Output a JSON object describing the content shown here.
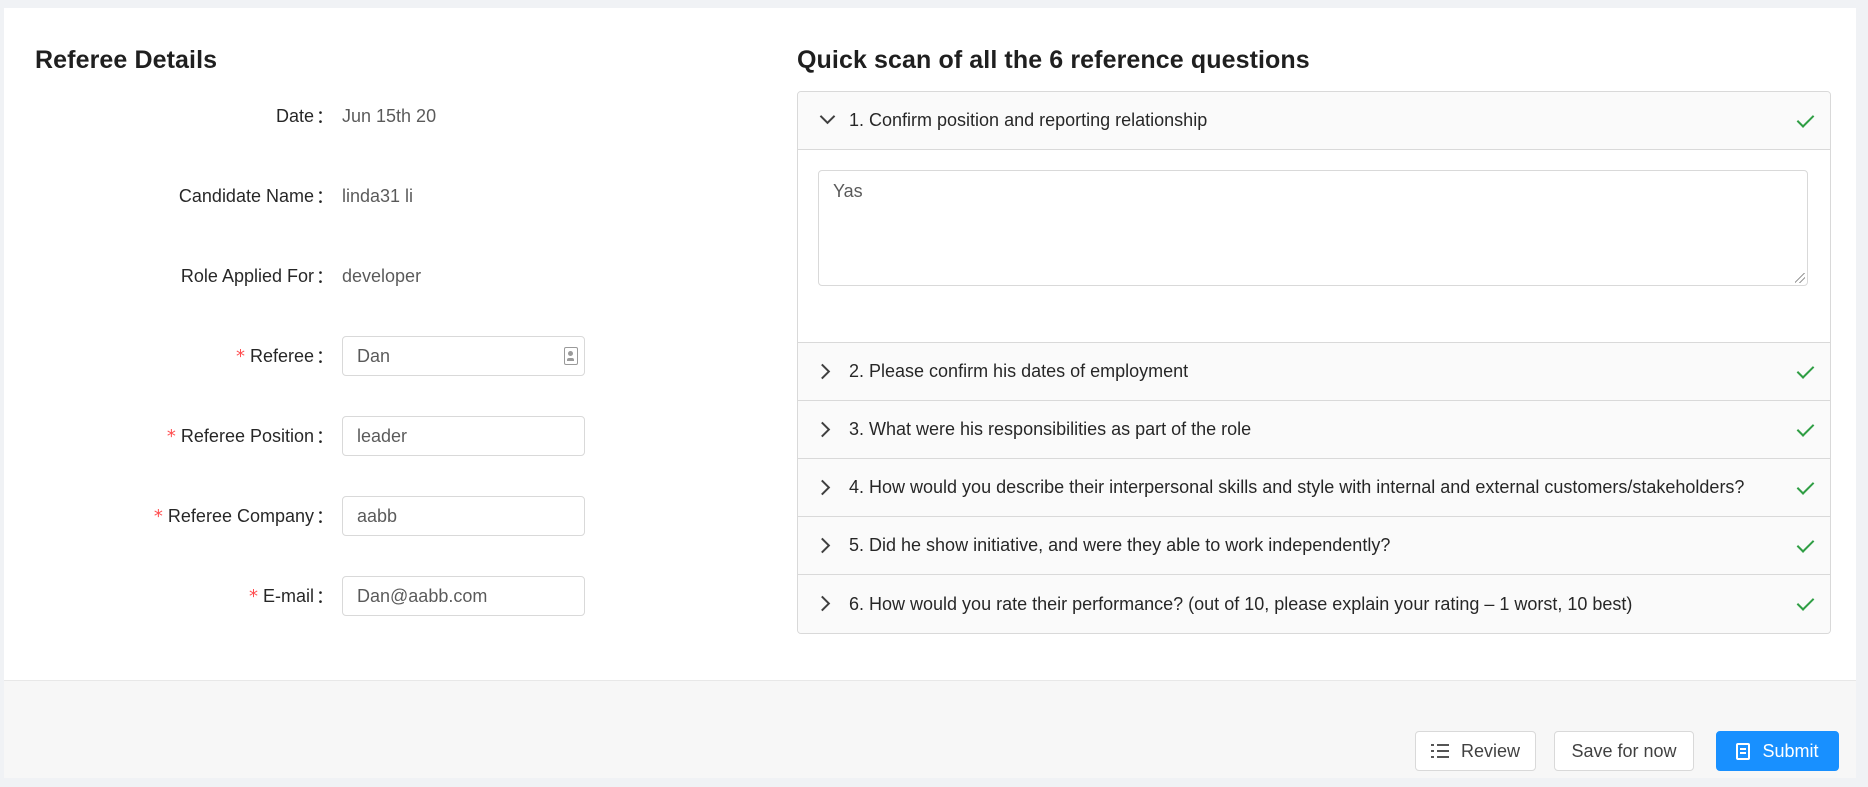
{
  "referee_details": {
    "title": "Referee Details",
    "fields": [
      {
        "label": "Date",
        "value": "Jun 15th 20",
        "required": false,
        "type": "text"
      },
      {
        "label": "Candidate Name",
        "value": "linda31 li",
        "required": false,
        "type": "text"
      },
      {
        "label": "Role Applied For",
        "value": "developer",
        "required": false,
        "type": "text"
      },
      {
        "label": "Referee",
        "value": "Dan",
        "required": true,
        "type": "input",
        "icon": "contact-card-icon"
      },
      {
        "label": "Referee Position",
        "value": "leader",
        "required": true,
        "type": "input"
      },
      {
        "label": "Referee Company",
        "value": "aabb",
        "required": true,
        "type": "input"
      },
      {
        "label": "E-mail",
        "value": "Dan@aabb.com",
        "required": true,
        "type": "input"
      }
    ],
    "colon": "："
  },
  "questions": {
    "title": "Quick scan of all the 6 reference questions",
    "items": [
      {
        "label": "1. Confirm position and reporting relationship",
        "expanded": true,
        "answer": "Yas",
        "complete": true
      },
      {
        "label": "2. Please confirm his dates of employment",
        "expanded": false,
        "complete": true
      },
      {
        "label": "3. What were his responsibilities as part of the role",
        "expanded": false,
        "complete": true
      },
      {
        "label": "4. How would you describe their interpersonal skills and style with internal and external customers/stakeholders?",
        "expanded": false,
        "complete": true
      },
      {
        "label": "5. Did he show initiative, and were they able to work independently?",
        "expanded": false,
        "complete": true
      },
      {
        "label": "6. How would you rate their performance? (out of 10, please explain your rating – 1 worst, 10 best)",
        "expanded": false,
        "complete": true
      }
    ]
  },
  "footer": {
    "review_label": "Review",
    "save_label": "Save for now",
    "submit_label": "Submit"
  },
  "colors": {
    "primary": "#1890ff",
    "required": "#ff4d4f",
    "check": "#2f9e44"
  }
}
